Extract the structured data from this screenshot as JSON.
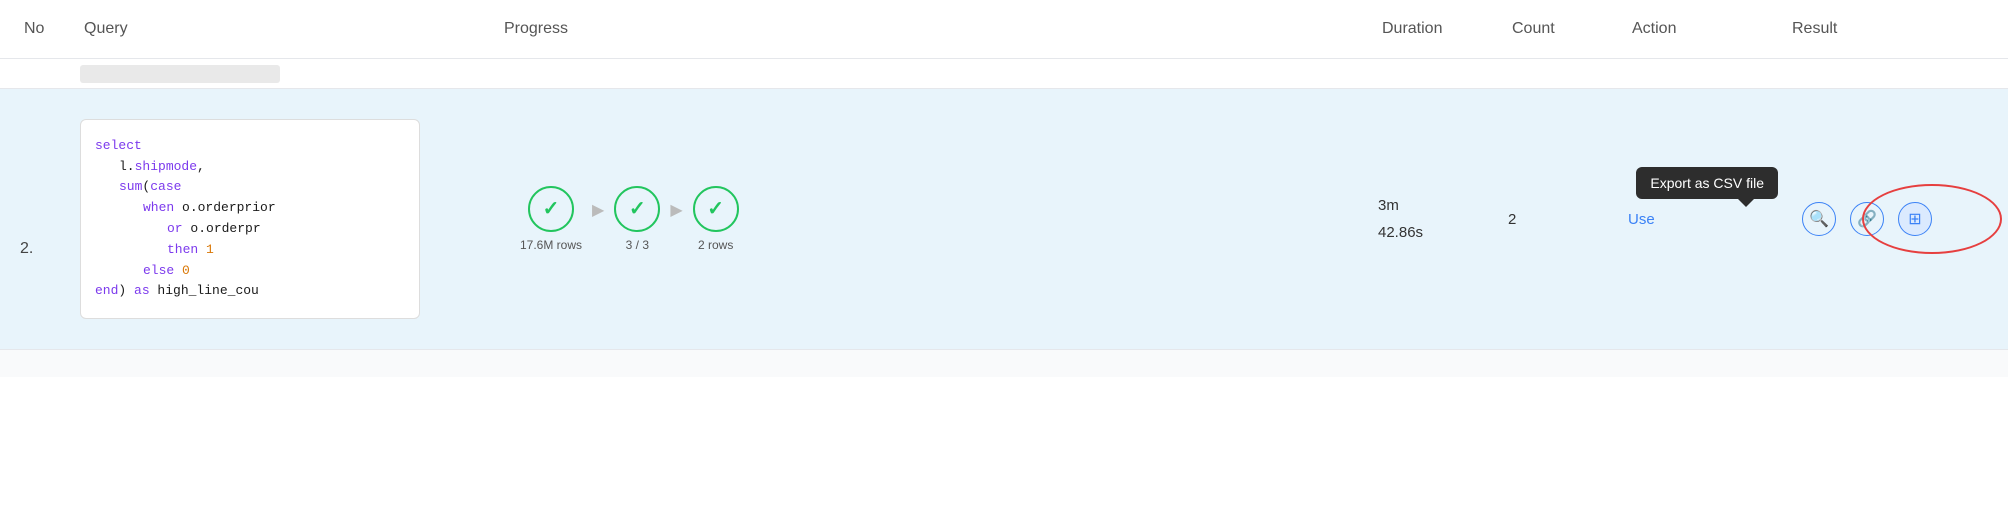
{
  "header": {
    "col_no": "No",
    "col_query": "Query",
    "col_progress": "Progress",
    "col_duration": "Duration",
    "col_count": "Count",
    "col_action": "Action",
    "col_result": "Result"
  },
  "rows": [
    {
      "num": "2.",
      "code": {
        "line1": "select",
        "line2": "l.shipmode,",
        "line3": "sum(case",
        "line4": "when o.orderprior",
        "line5": "or o.orderpr",
        "line6": "then 1",
        "line7": "else 0",
        "line8": "end) as high_line_cou"
      },
      "progress": [
        {
          "label": "17.6M rows"
        },
        {
          "label": "3 / 3"
        },
        {
          "label": "2 rows"
        }
      ],
      "duration_line1": "3m",
      "duration_line2": "42.86s",
      "count": "2",
      "action_label": "Use",
      "tooltip": "Export as CSV file"
    }
  ]
}
